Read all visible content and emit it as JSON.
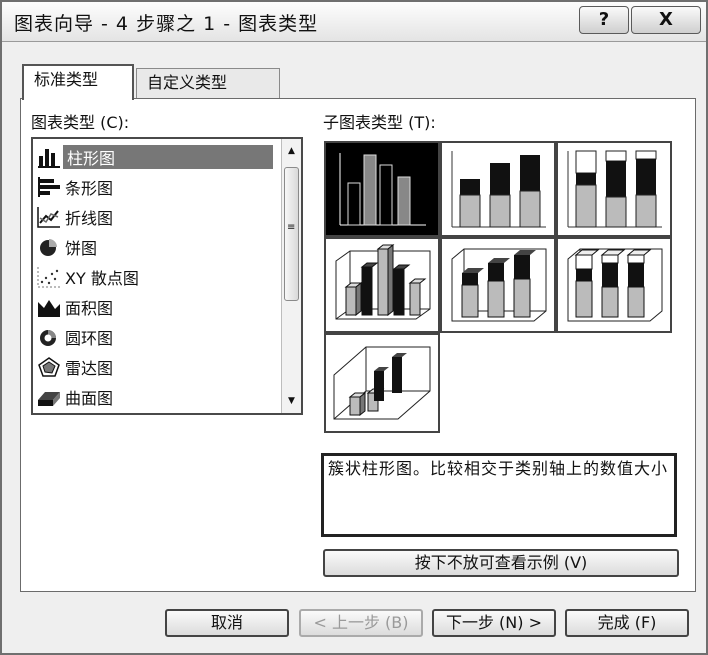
{
  "window": {
    "title": "图表向导 - 4 步骤之 1 - 图表类型",
    "help_label": "?",
    "close_label": "X"
  },
  "tabs": [
    {
      "label": "标准类型",
      "active": true
    },
    {
      "label": "自定义类型",
      "active": false
    }
  ],
  "chart_types": {
    "label": "图表类型 (C):",
    "items": [
      {
        "label": "柱形图",
        "icon": "column-chart-icon",
        "selected": true
      },
      {
        "label": "条形图",
        "icon": "bar-chart-icon"
      },
      {
        "label": "折线图",
        "icon": "line-chart-icon"
      },
      {
        "label": "饼图",
        "icon": "pie-chart-icon"
      },
      {
        "label": "XY 散点图",
        "icon": "scatter-chart-icon"
      },
      {
        "label": "面积图",
        "icon": "area-chart-icon"
      },
      {
        "label": "圆环图",
        "icon": "doughnut-chart-icon"
      },
      {
        "label": "雷达图",
        "icon": "radar-chart-icon"
      },
      {
        "label": "曲面图",
        "icon": "surface-chart-icon"
      }
    ]
  },
  "subtypes": {
    "label": "子图表类型 (T):",
    "items": [
      "clustered-column",
      "stacked-column",
      "100-stacked-column",
      "3d-clustered-column",
      "3d-stacked-column",
      "3d-100-stacked-column",
      "3d-column"
    ],
    "selected_index": 0
  },
  "description": "簇状柱形图。比较相交于类别轴上的数值大小",
  "preview_button": "按下不放可查看示例 (V)",
  "buttons": {
    "cancel": "取消",
    "back": "< 上一步 (B)",
    "next": "下一步 (N) >",
    "finish": "完成 (F)"
  }
}
